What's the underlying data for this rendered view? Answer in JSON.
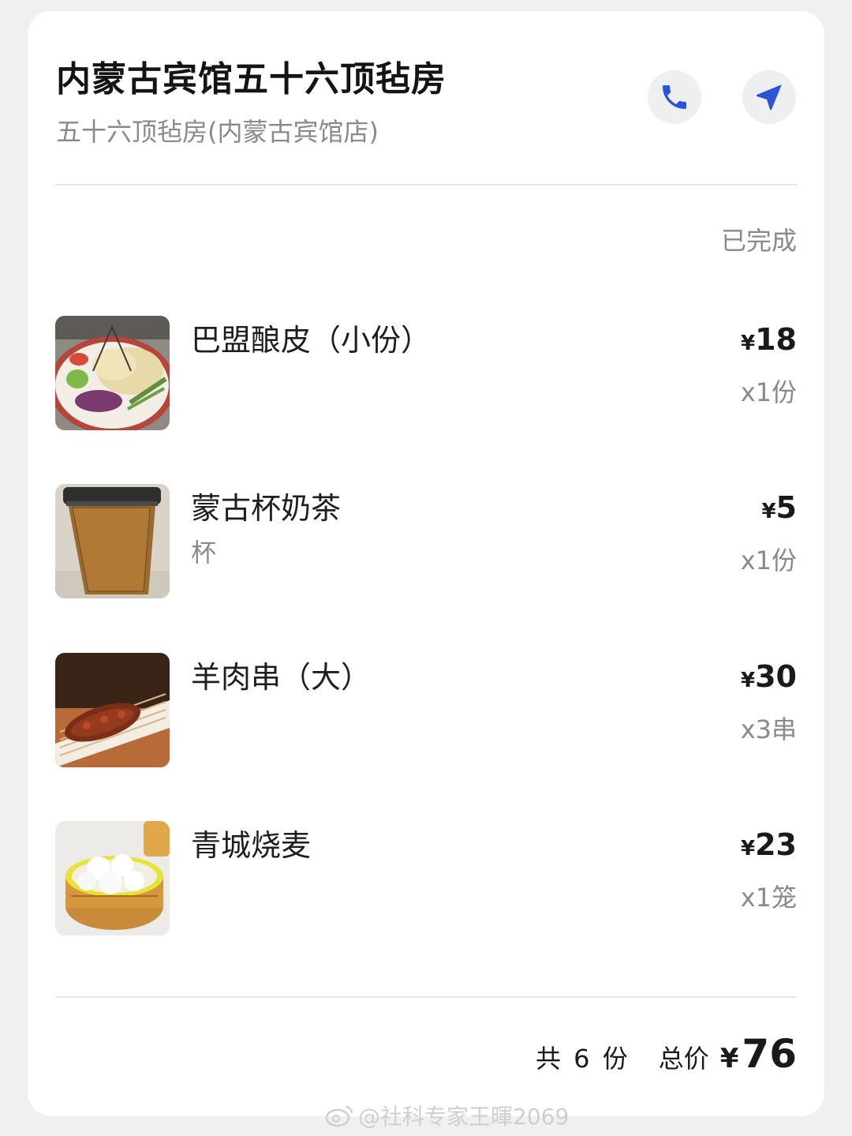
{
  "store": {
    "name": "内蒙古宾馆五十六顶毡房",
    "branch": "五十六顶毡房(内蒙古宾馆店)"
  },
  "actions": {
    "call_icon": "phone-icon",
    "navigate_icon": "location-arrow-icon",
    "accent_color": "#2b54d6"
  },
  "order": {
    "status": "已完成",
    "items": [
      {
        "name": "巴盟酿皮（小份）",
        "spec": "",
        "currency": "¥",
        "price": "18",
        "qty": "x1份"
      },
      {
        "name": "蒙古杯奶茶",
        "spec": "杯",
        "currency": "¥",
        "price": "5",
        "qty": "x1份"
      },
      {
        "name": "羊肉串（大）",
        "spec": "",
        "currency": "¥",
        "price": "30",
        "qty": "x3串"
      },
      {
        "name": "青城烧麦",
        "spec": "",
        "currency": "¥",
        "price": "23",
        "qty": "x1笼"
      }
    ],
    "summary": {
      "count_text": "共 6 份",
      "total_label": "总价",
      "currency": "¥",
      "total": "76"
    }
  },
  "watermark": "@社科专家王暉2069"
}
